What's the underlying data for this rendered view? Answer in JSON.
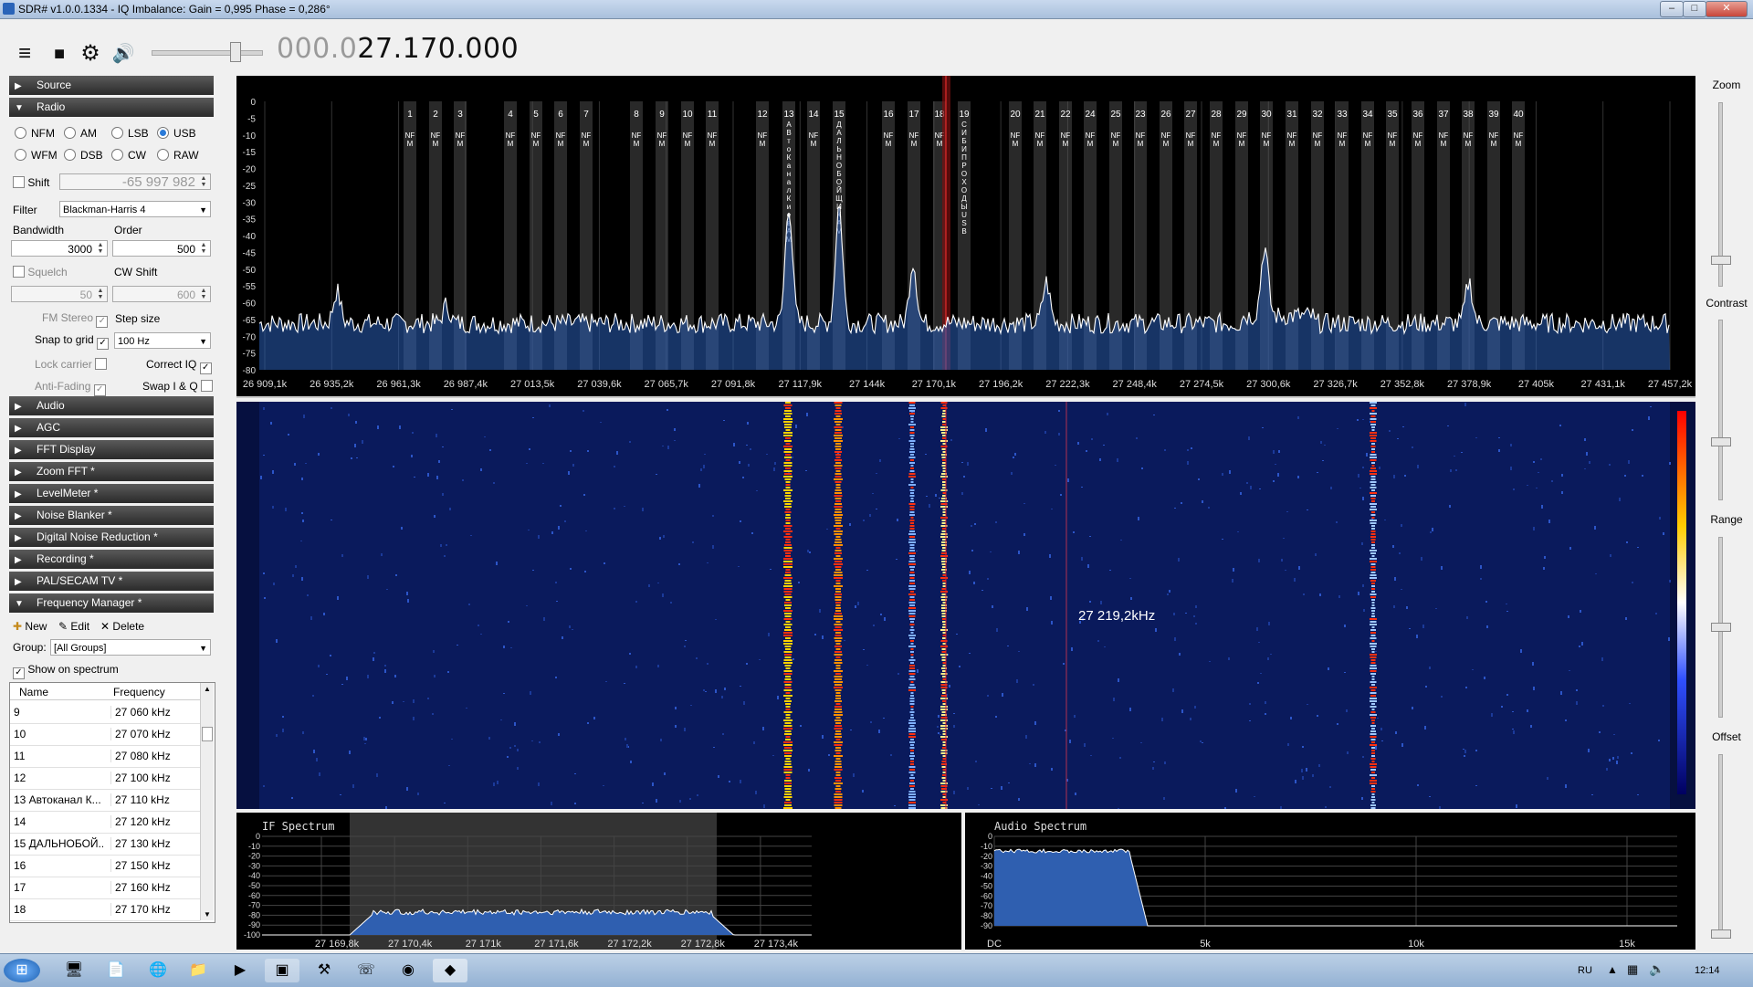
{
  "window": {
    "title": "SDR# v1.0.0.1334 - IQ Imbalance: Gain = 0,995 Phase = 0,286°",
    "min": "–",
    "max": "□",
    "close": "✕"
  },
  "toolbar": {
    "menu_icon": "≡",
    "stop_icon": "■",
    "settings_icon": "⚙",
    "volume_icon": "🔊",
    "freq_dim": "000.0",
    "freq_bright": "27.170.000"
  },
  "sections": {
    "source": "Source",
    "radio": "Radio",
    "audio": "Audio",
    "agc": "AGC",
    "fft": "FFT Display",
    "zoomfft": "Zoom FFT *",
    "levelmeter": "LevelMeter *",
    "noiseblanker": "Noise Blanker *",
    "dnr": "Digital Noise Reduction *",
    "recording": "Recording *",
    "palsecam": "PAL/SECAM TV *",
    "freqmgr": "Frequency Manager *"
  },
  "radio": {
    "modes": [
      "NFM",
      "AM",
      "LSB",
      "USB",
      "WFM",
      "DSB",
      "CW",
      "RAW"
    ],
    "selected_mode": "USB",
    "shift_label": "Shift",
    "shift_value": "-65 997 982",
    "filter_label": "Filter",
    "filter_value": "Blackman-Harris 4",
    "bandwidth_label": "Bandwidth",
    "bandwidth_value": "3000",
    "order_label": "Order",
    "order_value": "500",
    "squelch_label": "Squelch",
    "squelch_value": "50",
    "cwshift_label": "CW Shift",
    "cwshift_value": "600",
    "fmstereo_label": "FM Stereo",
    "stepsize_label": "Step size",
    "snap_label": "Snap to grid",
    "step_value": "100 Hz",
    "lockcarrier_label": "Lock carrier",
    "correctiq_label": "Correct IQ",
    "antifading_label": "Anti-Fading",
    "swapiq_label": "Swap I & Q"
  },
  "freqmgr": {
    "new": "New",
    "edit": "Edit",
    "delete": "Delete",
    "group_label": "Group:",
    "group_value": "[All Groups]",
    "show_on_spectrum": "Show on spectrum",
    "col_name": "Name",
    "col_freq": "Frequency",
    "rows": [
      {
        "name": "9",
        "freq": "27 060 kHz"
      },
      {
        "name": "10",
        "freq": "27 070 kHz"
      },
      {
        "name": "11",
        "freq": "27 080 kHz"
      },
      {
        "name": "12",
        "freq": "27 100 kHz"
      },
      {
        "name": "13 Автоканал К...",
        "freq": "27 110 kHz"
      },
      {
        "name": "14",
        "freq": "27 120 kHz"
      },
      {
        "name": "15 ДАЛЬНОБОЙ...",
        "freq": "27 130 kHz"
      },
      {
        "name": "16",
        "freq": "27 150 kHz"
      },
      {
        "name": "17",
        "freq": "27 160 kHz"
      },
      {
        "name": "18",
        "freq": "27 170 kHz"
      }
    ]
  },
  "spectrum": {
    "db_ticks": [
      "0",
      "-5",
      "-10",
      "-15",
      "-20",
      "-25",
      "-30",
      "-35",
      "-40",
      "-45",
      "-50",
      "-55",
      "-60",
      "-65",
      "-70",
      "-75",
      "-80"
    ],
    "freq_ticks": [
      "26 909,1k",
      "26 935,2k",
      "26 961,3k",
      "26 987,4k",
      "27 013,5k",
      "27 039,6k",
      "27 065,7k",
      "27 091,8k",
      "27 117,9k",
      "27 144k",
      "27 170,1k",
      "27 196,2k",
      "27 222,3k",
      "27 248,4k",
      "27 274,5k",
      "27 300,6k",
      "27 326,7k",
      "27 352,8k",
      "27 378,9k",
      "27 405k",
      "27 431,1k",
      "27 457,2k"
    ],
    "channels": [
      "1",
      "2",
      "3",
      "4",
      "5",
      "6",
      "7",
      "8",
      "9",
      "10",
      "11",
      "12",
      "13",
      "14",
      "15",
      "16",
      "17",
      "18",
      "19",
      "20",
      "21",
      "22",
      "24",
      "25",
      "23",
      "26",
      "27",
      "28",
      "29",
      "30",
      "31",
      "32",
      "33",
      "34",
      "35",
      "36",
      "37",
      "38",
      "39",
      "40"
    ],
    "channel_mode": "NFM",
    "ch13_text": "АВтоКаналКиевАМ",
    "ch15_text": "ДАЛЬНОБОЙЩИКАМ",
    "ch19_text": "СИБИПРОХОДЫUSB"
  },
  "waterfall": {
    "cursor_label": "27 219,2kHz"
  },
  "if_spectrum": {
    "title": "IF Spectrum",
    "db_ticks": [
      "0",
      "-10",
      "-20",
      "-30",
      "-40",
      "-50",
      "-60",
      "-70",
      "-80",
      "-90",
      "-100"
    ],
    "freq_ticks": [
      "27 169,8k",
      "27 170,4k",
      "27 171k",
      "27 171,6k",
      "27 172,2k",
      "27 172,8k",
      "27 173,4k"
    ]
  },
  "audio_spectrum": {
    "title": "Audio Spectrum",
    "db_ticks": [
      "0",
      "-10",
      "-20",
      "-30",
      "-40",
      "-50",
      "-60",
      "-70",
      "-80",
      "-90"
    ],
    "freq_ticks": [
      "DC",
      "5k",
      "10k",
      "15k"
    ]
  },
  "right": {
    "zoom": "Zoom",
    "contrast": "Contrast",
    "range": "Range",
    "offset": "Offset"
  },
  "taskbar": {
    "lang": "RU",
    "time": "12:14"
  },
  "colors": {
    "accent": "#2a7ad8",
    "spectrum_line": "#ffffff",
    "spectrum_fill": "#1e4fa0",
    "waterfall_bg": "#061040"
  }
}
